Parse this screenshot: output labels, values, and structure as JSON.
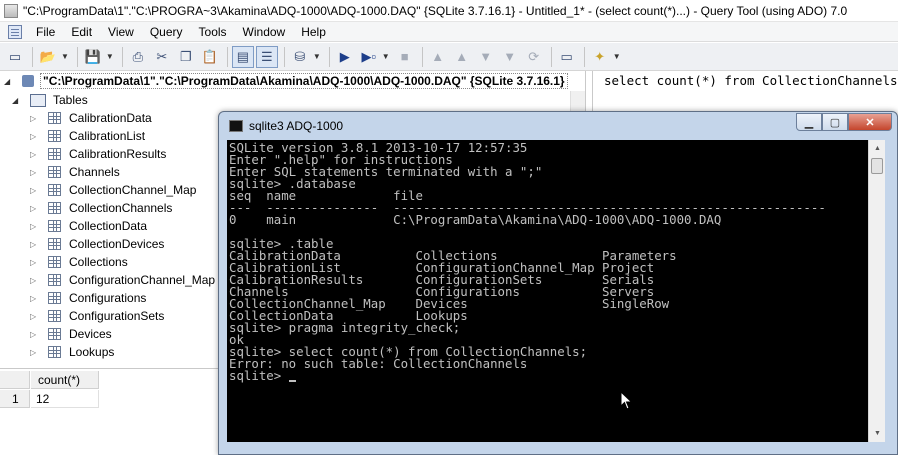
{
  "window": {
    "title": "\"C:\\ProgramData\\1\".\"C:\\PROGRA~3\\Akamina\\ADQ-1000\\ADQ-1000.DAQ\" {SQLite 3.7.16.1} - Untitled_1* - (select count(*)...) - Query Tool (using ADO) 7.0"
  },
  "menu": {
    "items": [
      "File",
      "Edit",
      "View",
      "Query",
      "Tools",
      "Window",
      "Help"
    ]
  },
  "tree": {
    "path": "\"C:\\ProgramData\\1\".\"C:\\ProgramData\\Akamina\\ADQ-1000\\ADQ-1000.DAQ\" {SQLite 3.7.16.1}",
    "tables_label": "Tables",
    "tables": [
      "CalibrationData",
      "CalibrationList",
      "CalibrationResults",
      "Channels",
      "CollectionChannel_Map",
      "CollectionChannels",
      "CollectionData",
      "CollectionDevices",
      "Collections",
      "ConfigurationChannel_Map",
      "Configurations",
      "ConfigurationSets",
      "Devices",
      "Lookups"
    ]
  },
  "editor": {
    "sql": "select count(*) from CollectionChannels"
  },
  "results": {
    "columns": [
      "count(*)"
    ],
    "rows": [
      [
        "1",
        "12"
      ]
    ]
  },
  "console": {
    "title": "sqlite3 ADQ-1000",
    "lines": [
      "SQLite version 3.8.1 2013-10-17 12:57:35",
      "Enter \".help\" for instructions",
      "Enter SQL statements terminated with a \";\"",
      "sqlite> .database",
      "seq  name             file",
      "---  ---------------  ----------------------------------------------------------",
      "0    main             C:\\ProgramData\\Akamina\\ADQ-1000\\ADQ-1000.DAQ",
      "",
      "sqlite> .table",
      "CalibrationData          Collections              Parameters",
      "CalibrationList          ConfigurationChannel_Map Project",
      "CalibrationResults       ConfigurationSets        Serials",
      "Channels                 Configurations           Servers",
      "CollectionChannel_Map    Devices                  SingleRow",
      "CollectionData           Lookups",
      "sqlite> pragma integrity_check;",
      "ok",
      "sqlite> select count(*) from CollectionChannels;",
      "Error: no such table: CollectionChannels"
    ],
    "prompt": "sqlite> "
  }
}
